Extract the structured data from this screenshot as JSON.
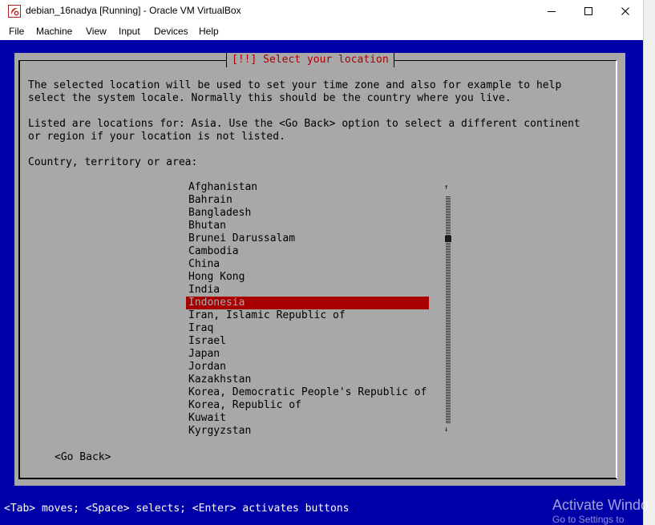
{
  "window": {
    "title": "debian_16nadya [Running] - Oracle VM VirtualBox",
    "menu": [
      "File",
      "Machine",
      "View",
      "Input",
      "Devices",
      "Help"
    ]
  },
  "colors": {
    "vm_background": "#0000a8",
    "dialog_background": "#a8a8a8",
    "accent_red": "#a80000",
    "status_text": "#ffffff"
  },
  "dialog": {
    "title": "[!!] Select your location",
    "paragraph1_line1": "The selected location will be used to set your time zone and also for example to help",
    "paragraph1_line2": "select the system locale. Normally this should be the country where you live.",
    "paragraph2_line1": "Listed are locations for: Asia. Use the <Go Back> option to select a different continent",
    "paragraph2_line2": "or region if your location is not listed.",
    "prompt": "Country, territory or area:",
    "countries": [
      "Afghanistan",
      "Bahrain",
      "Bangladesh",
      "Bhutan",
      "Brunei Darussalam",
      "Cambodia",
      "China",
      "Hong Kong",
      "India",
      "Indonesia",
      "Iran, Islamic Republic of",
      "Iraq",
      "Israel",
      "Japan",
      "Jordan",
      "Kazakhstan",
      "Korea, Democratic People's Republic of",
      "Korea, Republic of",
      "Kuwait",
      "Kyrgyzstan"
    ],
    "selected_country": "Indonesia",
    "scroll_up_icon": "up-arrow-icon",
    "scroll_down_icon": "down-arrow-icon",
    "go_back_label": "<Go Back>"
  },
  "statusbar": {
    "text": "<Tab> moves; <Space> selects; <Enter> activates buttons"
  },
  "watermark": {
    "line1": "Activate Windo",
    "line2": "Go to Settings to"
  }
}
